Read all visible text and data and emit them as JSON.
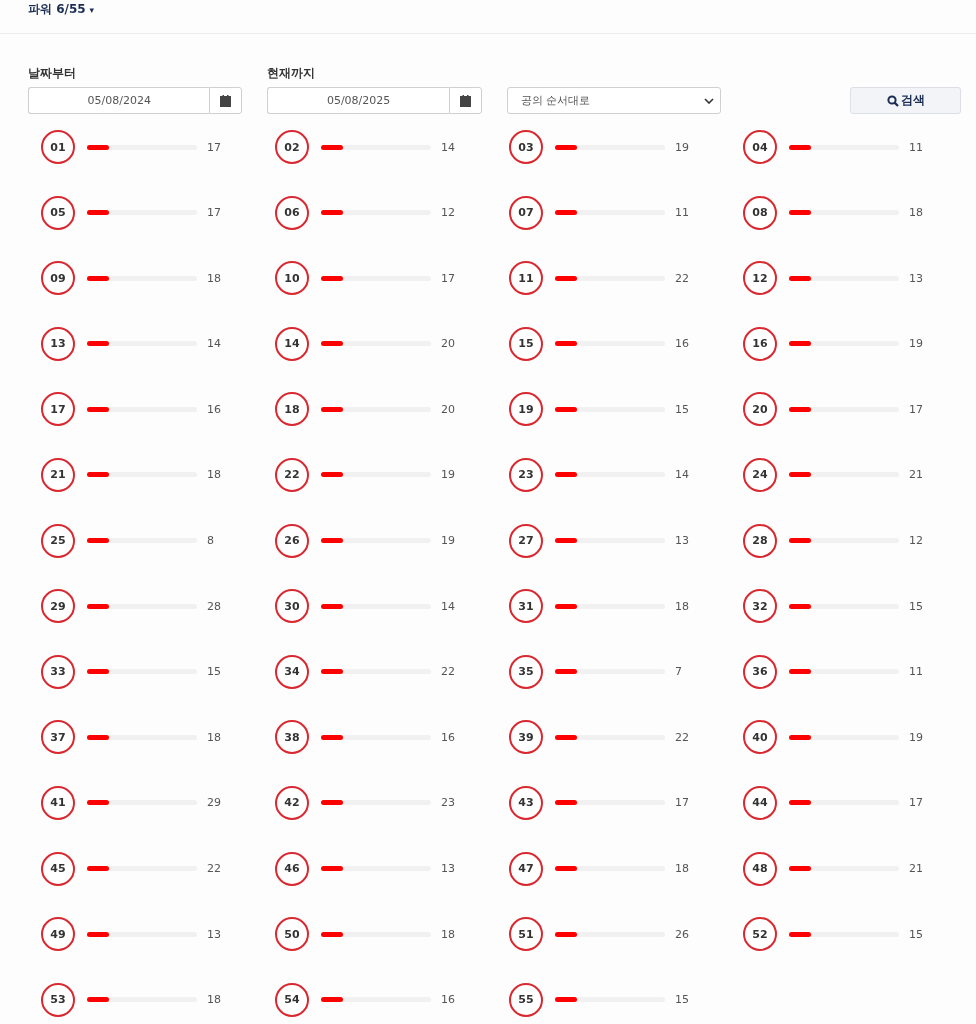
{
  "header": {
    "title": "파워 6/55",
    "caret": "▾"
  },
  "filters": {
    "from": {
      "label": "날짜부터",
      "value": "05/08/2024"
    },
    "to": {
      "label": "현재까지",
      "value": "05/08/2025"
    },
    "sort": {
      "value": "공의 순서대로"
    },
    "search_button": "검색"
  },
  "balls": [
    {
      "number": "01",
      "count": "17",
      "level": 0.2
    },
    {
      "number": "02",
      "count": "14",
      "level": 0.2
    },
    {
      "number": "03",
      "count": "19",
      "level": 0.2
    },
    {
      "number": "04",
      "count": "11",
      "level": 0.2
    },
    {
      "number": "05",
      "count": "17",
      "level": 0.2
    },
    {
      "number": "06",
      "count": "12",
      "level": 0.2
    },
    {
      "number": "07",
      "count": "11",
      "level": 0.2
    },
    {
      "number": "08",
      "count": "18",
      "level": 0.2
    },
    {
      "number": "09",
      "count": "18",
      "level": 0.2
    },
    {
      "number": "10",
      "count": "17",
      "level": 0.2
    },
    {
      "number": "11",
      "count": "22",
      "level": 0.2
    },
    {
      "number": "12",
      "count": "13",
      "level": 0.2
    },
    {
      "number": "13",
      "count": "14",
      "level": 0.2
    },
    {
      "number": "14",
      "count": "20",
      "level": 0.2
    },
    {
      "number": "15",
      "count": "16",
      "level": 0.2
    },
    {
      "number": "16",
      "count": "19",
      "level": 0.2
    },
    {
      "number": "17",
      "count": "16",
      "level": 0.2
    },
    {
      "number": "18",
      "count": "20",
      "level": 0.2
    },
    {
      "number": "19",
      "count": "15",
      "level": 0.2
    },
    {
      "number": "20",
      "count": "17",
      "level": 0.2
    },
    {
      "number": "21",
      "count": "18",
      "level": 0.2
    },
    {
      "number": "22",
      "count": "19",
      "level": 0.2
    },
    {
      "number": "23",
      "count": "14",
      "level": 0.2
    },
    {
      "number": "24",
      "count": "21",
      "level": 0.2
    },
    {
      "number": "25",
      "count": "8",
      "level": 0.2
    },
    {
      "number": "26",
      "count": "19",
      "level": 0.2
    },
    {
      "number": "27",
      "count": "13",
      "level": 0.2
    },
    {
      "number": "28",
      "count": "12",
      "level": 0.2
    },
    {
      "number": "29",
      "count": "28",
      "level": 0.2
    },
    {
      "number": "30",
      "count": "14",
      "level": 0.2
    },
    {
      "number": "31",
      "count": "18",
      "level": 0.2
    },
    {
      "number": "32",
      "count": "15",
      "level": 0.2
    },
    {
      "number": "33",
      "count": "15",
      "level": 0.2
    },
    {
      "number": "34",
      "count": "22",
      "level": 0.2
    },
    {
      "number": "35",
      "count": "7",
      "level": 0.2
    },
    {
      "number": "36",
      "count": "11",
      "level": 0.2
    },
    {
      "number": "37",
      "count": "18",
      "level": 0.2
    },
    {
      "number": "38",
      "count": "16",
      "level": 0.2
    },
    {
      "number": "39",
      "count": "22",
      "level": 0.2
    },
    {
      "number": "40",
      "count": "19",
      "level": 0.2
    },
    {
      "number": "41",
      "count": "29",
      "level": 0.2
    },
    {
      "number": "42",
      "count": "23",
      "level": 0.2
    },
    {
      "number": "43",
      "count": "17",
      "level": 0.2
    },
    {
      "number": "44",
      "count": "17",
      "level": 0.2
    },
    {
      "number": "45",
      "count": "22",
      "level": 0.2
    },
    {
      "number": "46",
      "count": "13",
      "level": 0.2
    },
    {
      "number": "47",
      "count": "18",
      "level": 0.2
    },
    {
      "number": "48",
      "count": "21",
      "level": 0.2
    },
    {
      "number": "49",
      "count": "13",
      "level": 0.2
    },
    {
      "number": "50",
      "count": "18",
      "level": 0.2
    },
    {
      "number": "51",
      "count": "26",
      "level": 0.2
    },
    {
      "number": "52",
      "count": "15",
      "level": 0.2
    },
    {
      "number": "53",
      "count": "18",
      "level": 0.2
    },
    {
      "number": "54",
      "count": "16",
      "level": 0.2
    },
    {
      "number": "55",
      "count": "15",
      "level": 0.2
    }
  ]
}
